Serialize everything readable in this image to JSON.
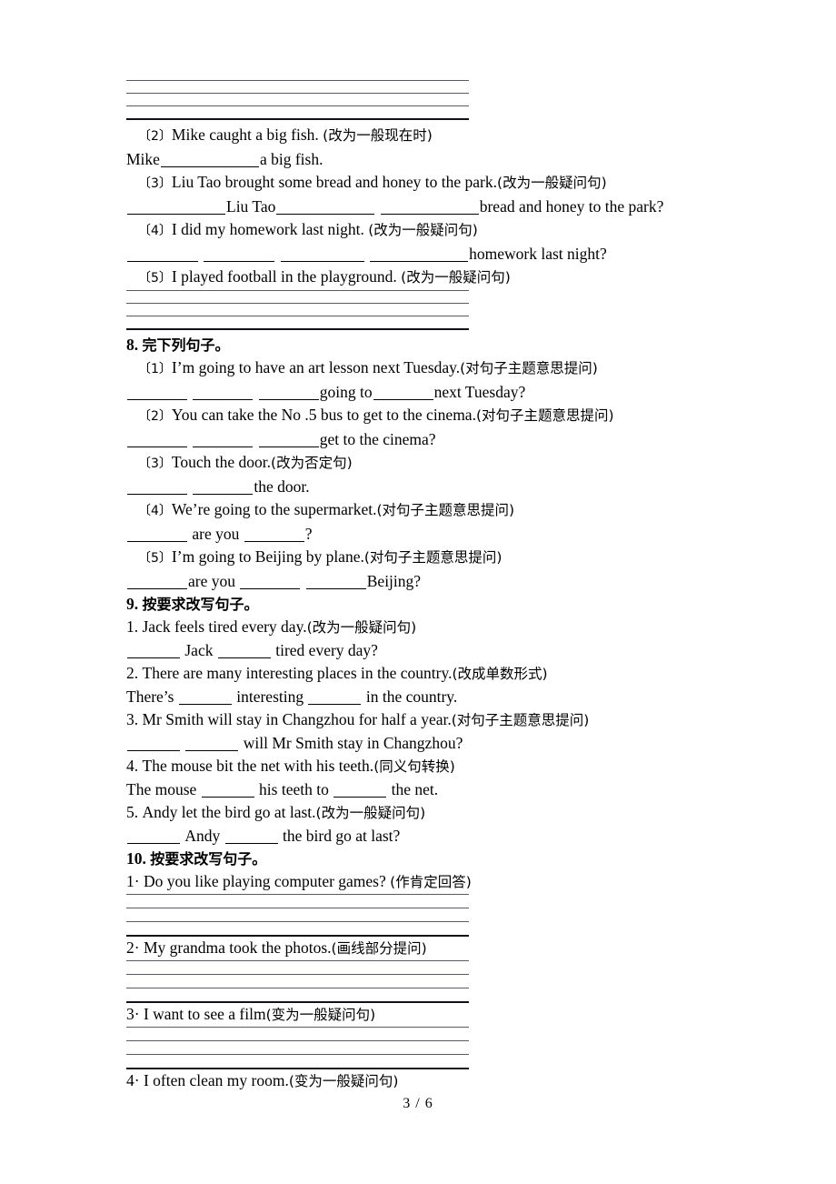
{
  "document": {
    "footer_page": "3 / 6",
    "blank_glyph": "_"
  },
  "top_answer_lines": {
    "count": 3
  },
  "section7_tail": {
    "items": [
      {
        "number": "〔2〕",
        "prompt": "Mike caught a big fish.",
        "instruction": "(改为一般现在时)",
        "answer_prefix": "Mike",
        "answer_suffix": "a big fish."
      },
      {
        "number": "〔3〕",
        "prompt": "Liu Tao brought some bread and honey to the park.",
        "instruction": "(改为一般疑问句)",
        "answer_mid": "Liu Tao",
        "answer_suffix": "bread and honey to the park?"
      },
      {
        "number": "〔4〕",
        "prompt": "I did my homework last night.",
        "instruction": "(改为一般疑问句)",
        "answer_suffix": "homework last night?"
      },
      {
        "number": "〔5〕",
        "prompt": "I played football in the playground.",
        "instruction": "(改为一般疑问句)",
        "answer_lines": 3
      }
    ]
  },
  "section8": {
    "heading_number": "8.",
    "heading_text": "完下列句子。",
    "items": [
      {
        "number": "〔1〕",
        "prompt": "I’m going to have an art lesson next Tuesday.",
        "instruction": "(对句子主题意思提问)",
        "answer_mid": "going to",
        "answer_suffix": "next Tuesday?"
      },
      {
        "number": "〔2〕",
        "prompt": "You can take the No .5 bus to get to the cinema.",
        "instruction": "(对句子主题意思提问)",
        "answer_suffix": "get to the cinema?"
      },
      {
        "number": "〔3〕",
        "prompt": "Touch the door.",
        "instruction": "(改为否定句)",
        "answer_suffix": "the door."
      },
      {
        "number": "〔4〕",
        "prompt": "We’re going to the supermarket.",
        "instruction": "(对句子主题意思提问)",
        "answer_mid": "are you",
        "answer_suffix": "?"
      },
      {
        "number": "〔5〕",
        "prompt": "I’m going to Beijing by plane.",
        "instruction": "(对句子主题意思提问)",
        "answer_mid": "are you",
        "answer_suffix": "Beijing?"
      }
    ]
  },
  "section9": {
    "heading_number": "9.",
    "heading_text": "按要求改写句子。",
    "items": [
      {
        "number": "1.",
        "prompt": "Jack feels tired every day.",
        "instruction": "(改为一般疑问句)",
        "answer_mid": "Jack",
        "answer_suffix": "tired every day?"
      },
      {
        "number": "2.",
        "prompt": "There are many interesting places in the country.",
        "instruction": "(改成单数形式)",
        "answer_prefix": "There’s",
        "answer_mid": "interesting",
        "answer_suffix": "in the country."
      },
      {
        "number": "3.",
        "prompt": "Mr Smith will stay in Changzhou for half a year.",
        "instruction": "(对句子主题意思提问)",
        "answer_suffix": "will Mr Smith stay in Changzhou?"
      },
      {
        "number": "4.",
        "prompt": "The mouse bit the net with his teeth.",
        "instruction": "(同义句转换)",
        "answer_prefix": "The mouse",
        "answer_mid": "his teeth to",
        "answer_suffix": "the net."
      },
      {
        "number": "5.",
        "prompt": "Andy let the bird go at last.",
        "instruction": "(改为一般疑问句)",
        "answer_mid": "Andy",
        "answer_suffix": "the bird go at last?"
      }
    ]
  },
  "section10": {
    "heading_number": "10.",
    "heading_text": "按要求改写句子。",
    "items": [
      {
        "number": "1·",
        "prompt": "Do you like playing computer games?",
        "instruction": "(作肯定回答)",
        "answer_lines": 3
      },
      {
        "number": "2·",
        "prompt": "My grandma took the photos.",
        "instruction": "(画线部分提问)",
        "answer_lines": 3
      },
      {
        "number": "3·",
        "prompt": "I want to see a film",
        "instruction": "(变为一般疑问句)",
        "answer_lines": 3
      },
      {
        "number": "4·",
        "prompt": "I often clean my room.",
        "instruction": "(变为一般疑问句)",
        "answer_lines": 0
      }
    ]
  }
}
